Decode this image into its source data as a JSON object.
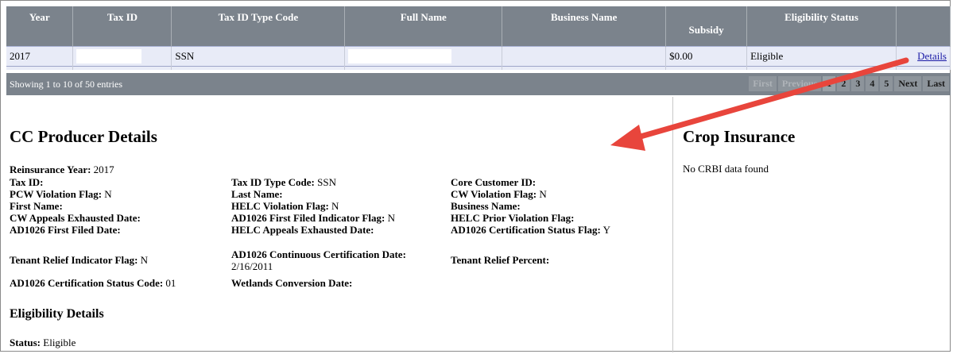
{
  "table": {
    "headers": [
      "Year",
      "Tax ID",
      "Tax ID Type Code",
      "Full Name",
      "Business Name",
      "Subsidy",
      "Eligibility Status",
      ""
    ],
    "row": {
      "year": "2017",
      "tax_id_type_code": "SSN",
      "subsidy": "$0.00",
      "eligibility_status": "Eligible",
      "details_link": "Details"
    }
  },
  "pager": {
    "info": "Showing 1 to 10 of 50 entries",
    "buttons": [
      "First",
      "Previous",
      "1",
      "2",
      "3",
      "4",
      "5",
      "Next",
      "Last"
    ]
  },
  "producer": {
    "title": "CC Producer Details",
    "reinsurance_year": {
      "label": "Reinsurance Year:",
      "value": "2017"
    },
    "col1": [
      {
        "label": "Tax ID:",
        "value": ""
      },
      {
        "label": "PCW Violation Flag:",
        "value": "N"
      },
      {
        "label": "First Name:",
        "value": ""
      },
      {
        "label": "CW Appeals Exhausted Date:",
        "value": ""
      },
      {
        "label": "AD1026 First Filed Date:",
        "value": ""
      },
      {
        "label": "Tenant Relief Indicator Flag:",
        "value": "N"
      },
      {
        "label": "AD1026 Certification Status Code:",
        "value": "01"
      }
    ],
    "col2": [
      {
        "label": "Tax ID Type Code:",
        "value": "SSN"
      },
      {
        "label": "Last Name:",
        "value": ""
      },
      {
        "label": "HELC Violation Flag:",
        "value": "N"
      },
      {
        "label": "AD1026 First Filed Indicator Flag:",
        "value": "N"
      },
      {
        "label": "HELC Appeals Exhausted Date:",
        "value": ""
      },
      {
        "label": "AD1026 Continuous Certification Date:",
        "value": "2/16/2011"
      },
      {
        "label": "Wetlands Conversion Date:",
        "value": ""
      }
    ],
    "col3": [
      {
        "label": "Core Customer ID:",
        "value": ""
      },
      {
        "label": "CW Violation Flag:",
        "value": "N"
      },
      {
        "label": "Business Name:",
        "value": ""
      },
      {
        "label": "HELC Prior Violation Flag:",
        "value": ""
      },
      {
        "label": "AD1026 Certification Status Flag:",
        "value": "Y"
      },
      {
        "label": "Tenant Relief Percent:",
        "value": ""
      }
    ]
  },
  "eligibility": {
    "title": "Eligibility Details",
    "status_label": "Status:",
    "status_value": "Eligible"
  },
  "crop": {
    "title": "Crop Insurance",
    "message": "No CRBI data found"
  },
  "colors": {
    "header_bg": "#7b838c",
    "row_bg": "#e8ebf7",
    "arrow": "#e8453c",
    "link": "#1a1aa6"
  }
}
